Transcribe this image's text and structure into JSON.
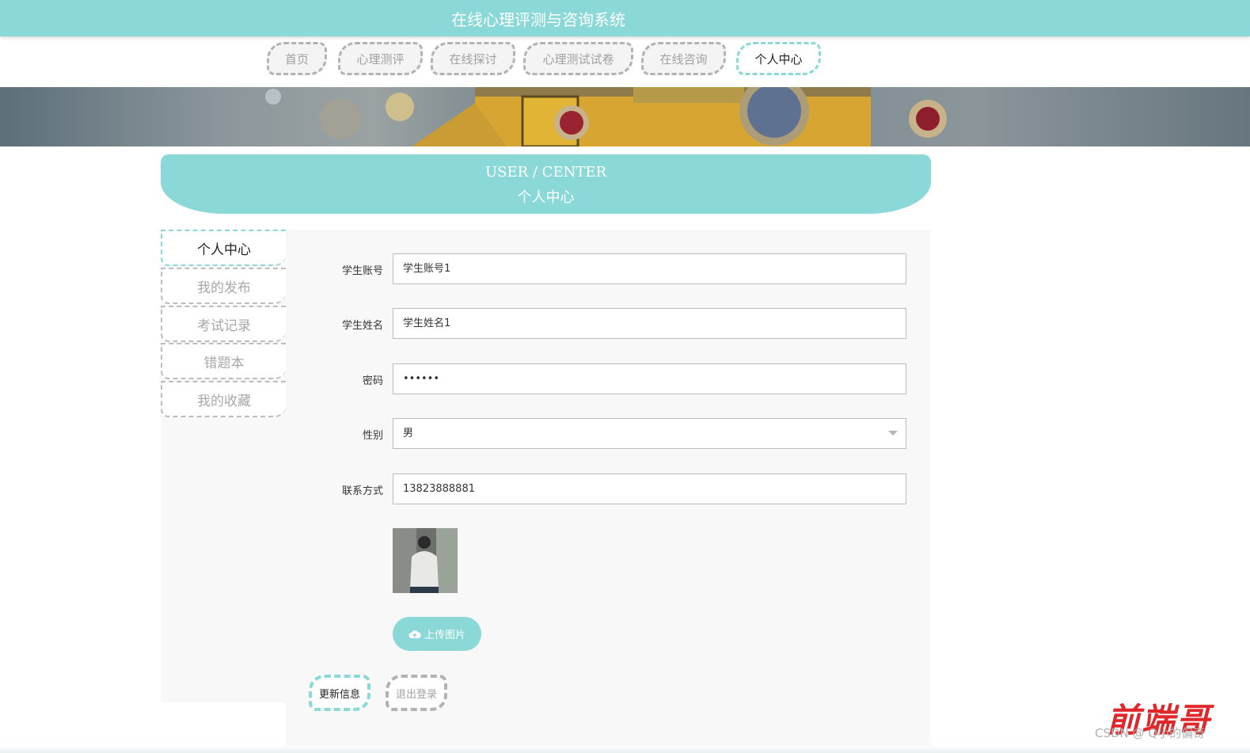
{
  "header": {
    "title": "在线心理评测与咨询系统"
  },
  "nav": {
    "items": [
      {
        "label": "首页",
        "active": false
      },
      {
        "label": "心理测评",
        "active": false
      },
      {
        "label": "在线探讨",
        "active": false
      },
      {
        "label": "心理测试试卷",
        "active": false
      },
      {
        "label": "在线咨询",
        "active": false
      },
      {
        "label": "个人中心",
        "active": true
      }
    ]
  },
  "center_head": {
    "en": "USER / CENTER",
    "zh": "个人中心"
  },
  "sidebar": {
    "items": [
      {
        "label": "个人中心",
        "active": true
      },
      {
        "label": "我的发布",
        "active": false
      },
      {
        "label": "考试记录",
        "active": false
      },
      {
        "label": "错题本",
        "active": false
      },
      {
        "label": "我的收藏",
        "active": false
      }
    ]
  },
  "form": {
    "account": {
      "label": "学生账号",
      "value": "学生账号1"
    },
    "name": {
      "label": "学生姓名",
      "value": "学生姓名1"
    },
    "password": {
      "label": "密码",
      "value": "••••••"
    },
    "gender": {
      "label": "性别",
      "value": "男"
    },
    "phone": {
      "label": "联系方式",
      "value": "13823888881"
    },
    "upload_label": "上传图片"
  },
  "actions": {
    "update": "更新信息",
    "logout": "退出登录"
  },
  "watermark": {
    "brand": "前端哥",
    "csdn": "CSDN @ Q小的偏奇"
  },
  "colors": {
    "accent": "#8ad8d8",
    "dashed_gray": "#b3b3b3",
    "panel_bg": "#f8f8f8",
    "watermark_red": "#e0282c"
  },
  "icons": {
    "upload": "cloud-upload-icon",
    "select": "chevron-down-icon"
  }
}
